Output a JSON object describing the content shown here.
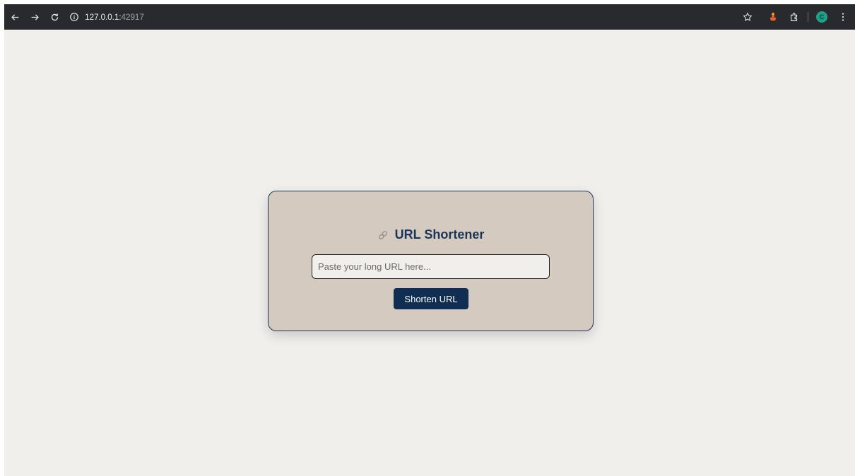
{
  "browser": {
    "url_host": "127.0.0.1:",
    "url_port": "42917"
  },
  "app": {
    "title": "URL Shortener",
    "input_placeholder": "Paste your long URL here...",
    "input_value": "",
    "button_label": "Shorten URL"
  },
  "profile": {
    "initial": "C"
  },
  "colors": {
    "page_bg": "#f0efeb",
    "card_bg": "#d5cac0",
    "accent": "#102d52"
  },
  "icons": [
    "back-arrow-icon",
    "forward-arrow-icon",
    "reload-icon",
    "info-icon",
    "star-icon",
    "extension-app-icon",
    "puzzle-icon",
    "menu-kebab-icon",
    "link-icon"
  ]
}
